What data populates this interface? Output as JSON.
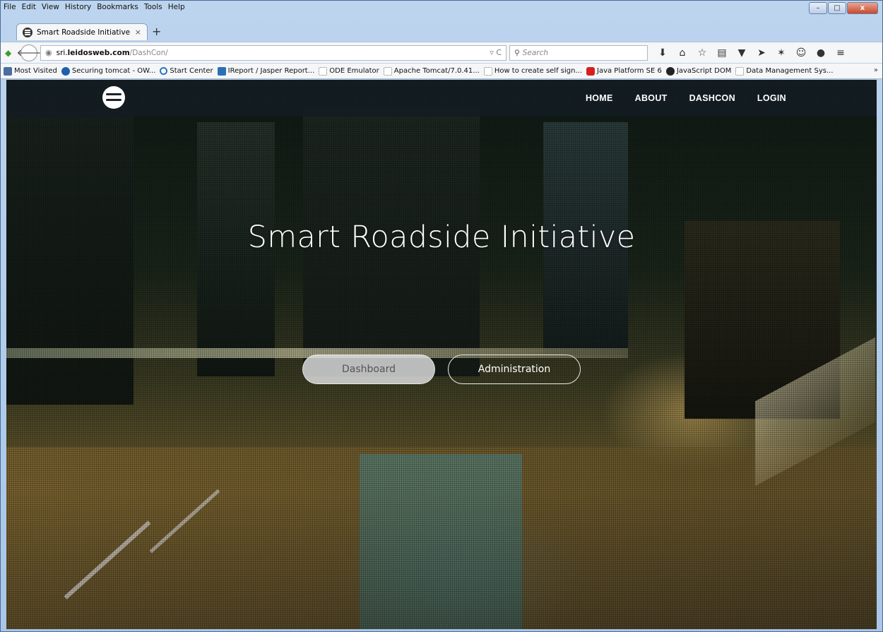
{
  "menu": [
    "File",
    "Edit",
    "View",
    "History",
    "Bookmarks",
    "Tools",
    "Help"
  ],
  "window_controls": {
    "minimize": "–",
    "maximize": "□",
    "close": "x"
  },
  "tab": {
    "title": "Smart Roadside Initiative - ...",
    "close": "×",
    "new": "+"
  },
  "address": {
    "domain_prefix": "sri.",
    "domain": "leidosweb.com",
    "path": "/DashCon/"
  },
  "search": {
    "placeholder": "Search"
  },
  "bookmarks": [
    {
      "label": "Most Visited",
      "icon": "most-visited-icon"
    },
    {
      "label": "Securing tomcat - OW...",
      "icon": "globe-icon"
    },
    {
      "label": "Start Center",
      "icon": "ring-icon"
    },
    {
      "label": "IReport / Jasper Report...",
      "icon": "jasper-icon"
    },
    {
      "label": "ODE Emulator",
      "icon": "page-icon"
    },
    {
      "label": "Apache Tomcat/7.0.41...",
      "icon": "page-icon"
    },
    {
      "label": "How to create self sign...",
      "icon": "page-icon"
    },
    {
      "label": "Java Platform SE 6",
      "icon": "oracle-icon"
    },
    {
      "label": "JavaScript DOM",
      "icon": "cat-icon"
    },
    {
      "label": "Data Management Sys...",
      "icon": "page-icon"
    }
  ],
  "bookmarks_more": "»",
  "site": {
    "nav": [
      "HOME",
      "ABOUT",
      "DASHCON",
      "LOGIN"
    ],
    "title": "Smart Roadside Initiative",
    "buttons": {
      "dashboard": "Dashboard",
      "administration": "Administration"
    }
  }
}
